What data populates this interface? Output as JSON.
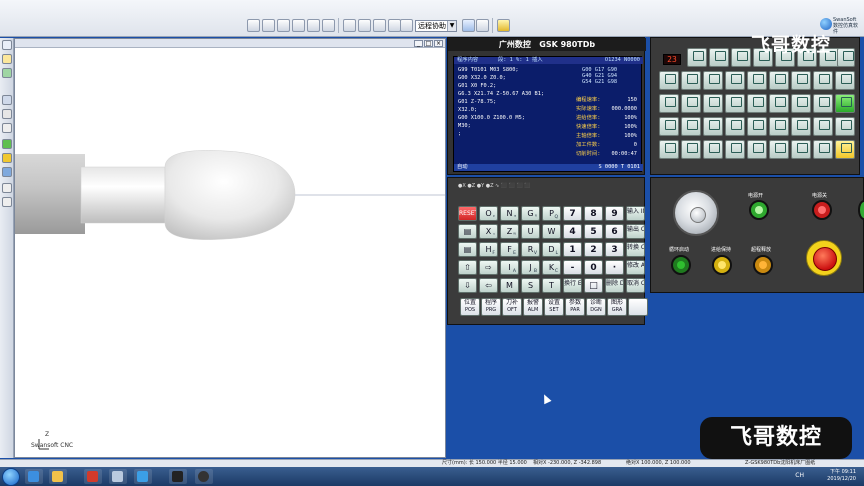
{
  "toolbar": {
    "mode_select": "远程协助"
  },
  "brand": {
    "name": "SwanSoft",
    "subtitle": "数控仿真软件"
  },
  "viewport": {
    "label": "Swansoft CNC",
    "axis": "Z"
  },
  "controller": {
    "header_left": "广州数控",
    "header_right": "GSK 980TDb",
    "lcd": {
      "title_left": "程序内容",
      "title_mid": "段: 1  %: 1  插入",
      "title_right": "O1234 N0000",
      "program_lines": [
        "G99 T0101 M03 S800;",
        "G00 X32.0 Z0.0;",
        "G01 X0 F0.2;",
        "G6.3 X21.74 Z-50.67 A30 B1;",
        "G01 Z-78.75;",
        "X32.0;",
        "G00 X100.0 Z100.0 M5;",
        "M30;",
        ";"
      ],
      "modal_codes": [
        "G00  G17  G90",
        "G40  G21  G94",
        "G54  G21  G98"
      ],
      "status": [
        {
          "label": "编程速率:",
          "value": "150"
        },
        {
          "label": "实际速率:",
          "value": "000.0000"
        },
        {
          "label": "进给倍率:",
          "value": "100%"
        },
        {
          "label": "快速倍率:",
          "value": "100%"
        },
        {
          "label": "主轴倍率:",
          "value": "100%"
        },
        {
          "label": "加工件数:",
          "value": "0"
        },
        {
          "label": "切削时间:",
          "value": "00:00:47"
        }
      ],
      "bottom_left": "自动",
      "bottom_right": "S 0000   T 0101"
    },
    "seg_display": "23",
    "keypad": {
      "top_row": "●X  ●Z  ●Y  ●Z  ∿  ⬛  ⬛  ⬛  ⬛",
      "rows": [
        [
          {
            "t": "RESET",
            "cls": "red"
          },
          {
            "t": "O",
            "s": "ᵖ"
          },
          {
            "t": "N",
            "s": "ᵠ"
          },
          {
            "t": "G",
            "s": "ᴿ"
          },
          {
            "t": "P",
            "s": "Q"
          },
          {
            "t": "7",
            "cls": "num"
          },
          {
            "t": "8",
            "cls": "num"
          },
          {
            "t": "9",
            "cls": "num"
          },
          {
            "t": "输入 IN",
            "cls": "small"
          }
        ],
        [
          {
            "t": "▤"
          },
          {
            "t": "X",
            "s": "ᵘ"
          },
          {
            "t": "Z",
            "s": "ᵂ"
          },
          {
            "t": "U",
            "s": ""
          },
          {
            "t": "W",
            "s": ""
          },
          {
            "t": "4",
            "cls": "num"
          },
          {
            "t": "5",
            "cls": "num"
          },
          {
            "t": "6",
            "cls": "num"
          },
          {
            "t": "输出 OUT",
            "cls": "small"
          }
        ],
        [
          {
            "t": "▤"
          },
          {
            "t": "H",
            "s": "F"
          },
          {
            "t": "F",
            "s": "E"
          },
          {
            "t": "R",
            "s": "V"
          },
          {
            "t": "D",
            "s": "L"
          },
          {
            "t": "1",
            "cls": "num"
          },
          {
            "t": "2",
            "cls": "num"
          },
          {
            "t": "3",
            "cls": "num"
          },
          {
            "t": "转换 CHG",
            "cls": "small"
          }
        ],
        [
          {
            "t": "⇧"
          },
          {
            "t": "⇨"
          },
          {
            "t": "I",
            "s": "A"
          },
          {
            "t": "J",
            "s": "B"
          },
          {
            "t": "K",
            "s": "C"
          },
          {
            "t": "-",
            "cls": "num"
          },
          {
            "t": "0",
            "cls": "num"
          },
          {
            "t": "·",
            "cls": "num"
          },
          {
            "t": "修改 ALT",
            "cls": "small"
          }
        ],
        [
          {
            "t": "⇩"
          },
          {
            "t": "⇦"
          },
          {
            "t": "M",
            "s": ""
          },
          {
            "t": "S",
            "s": ""
          },
          {
            "t": "T",
            "s": ""
          },
          {
            "t": "换行 EOB",
            "cls": "small"
          },
          {
            "t": "□",
            "cls": "num"
          },
          {
            "t": "删除 DEL",
            "cls": "small"
          },
          {
            "t": "取消 CAN",
            "cls": "small"
          }
        ]
      ],
      "function_keys": [
        {
          "t": "位置",
          "s": "POS"
        },
        {
          "t": "程序",
          "s": "PRG"
        },
        {
          "t": "刀补",
          "s": "OFT"
        },
        {
          "t": "报警",
          "s": "ALM"
        },
        {
          "t": "设置",
          "s": "SET"
        },
        {
          "t": "参数",
          "s": "PAR"
        },
        {
          "t": "诊断",
          "s": "DGN"
        },
        {
          "t": "图形",
          "s": "GRA"
        }
      ]
    },
    "panel": {
      "power_on": "电源开",
      "power_off": "电源关",
      "cycle_start": "循环启动",
      "feed_hold": "进给保持",
      "overtravel_release": "超程释放"
    }
  },
  "status_bar": {
    "size": "尺寸(mm): 长 150.000 半径 15.000",
    "relative": "相对X -230.000, Z -342.898",
    "absolute": "绝对X 100.000, Z 100.000",
    "tail": "Z-GSK980TDb沈阳机床厂图纸"
  },
  "watermark": {
    "top": "飞哥数控",
    "bottom": "飞哥数控"
  },
  "taskbar": {
    "tray": "CH",
    "time": "下午 09:11",
    "date": "2019/12/20"
  },
  "colors": {
    "lcd": "#0b1d6a",
    "desktop": "#1b4fa8",
    "key": "#e8f3ef"
  }
}
